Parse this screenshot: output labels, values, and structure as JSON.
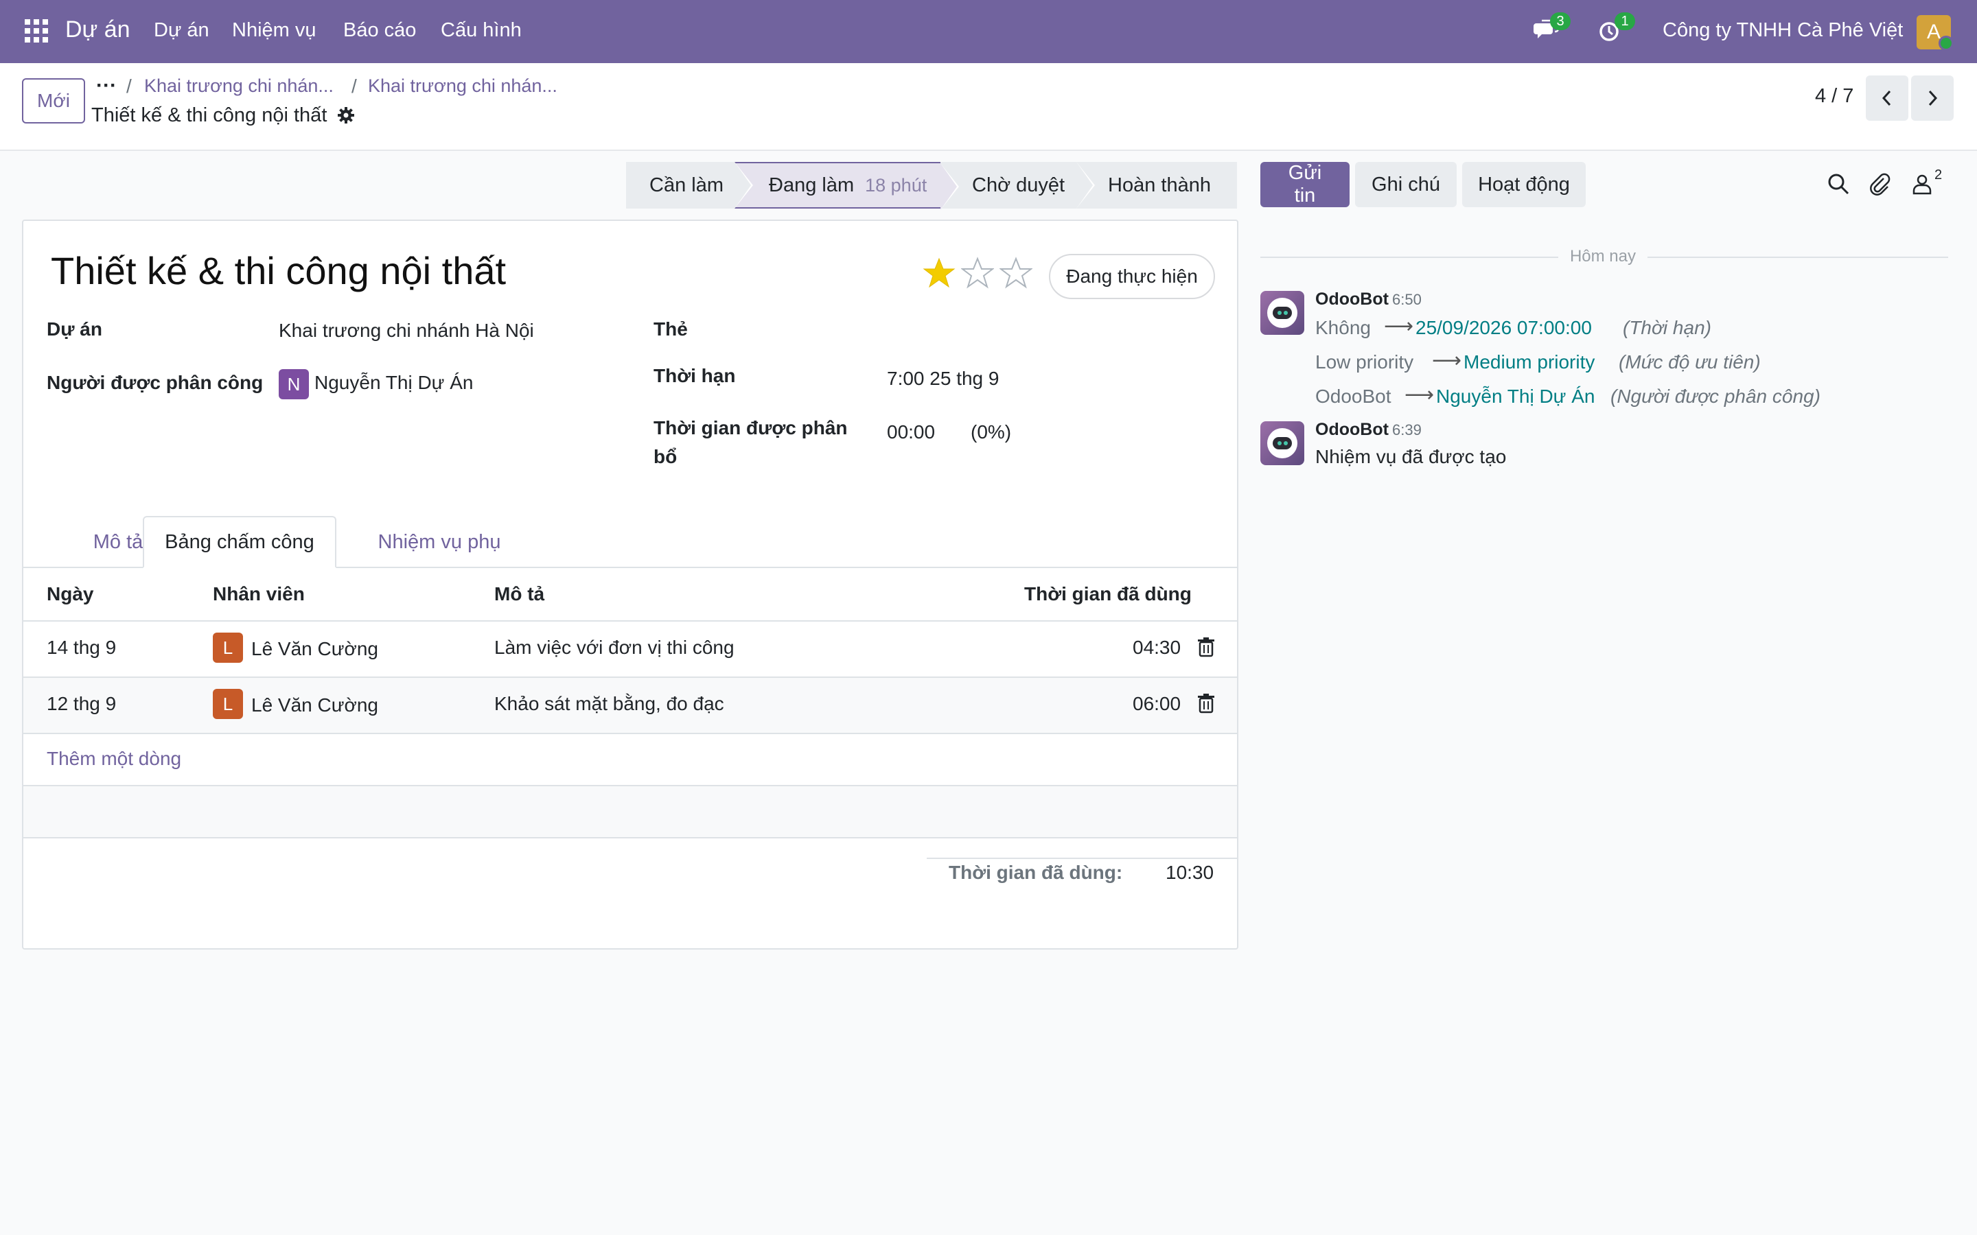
{
  "navbar": {
    "app_name": "Dự án",
    "menu": [
      "Dự án",
      "Nhiệm vụ",
      "Báo cáo",
      "Cấu hình"
    ],
    "messages_count": "3",
    "activities_count": "1",
    "company": "Công ty TNHH Cà Phê Việt",
    "user_initial": "A"
  },
  "control_panel": {
    "new_button": "Mới",
    "breadcrumbs": [
      "Khai trương chi nhán...",
      "Khai trương chi nhán..."
    ],
    "record_title": "Thiết kế & thi công nội thất",
    "pager": "4 / 7"
  },
  "statusbar": {
    "stages": [
      "Cần làm",
      "Đang làm",
      "Chờ duyệt",
      "Hoàn thành"
    ],
    "active_stage": "Đang làm",
    "active_duration": "18 phút"
  },
  "form": {
    "title": "Thiết kế & thi công nội thất",
    "priority_stars": 1,
    "priority_max": 3,
    "state_button": "Đang thực hiện",
    "fields": {
      "project_label": "Dự án",
      "project_value": "Khai trương chi nhánh Hà Nội",
      "assignee_label": "Người được phân công",
      "assignee_initial": "N",
      "assignee_value": "Nguyễn Thị Dự Án",
      "tags_label": "Thẻ",
      "deadline_label": "Thời hạn",
      "deadline_value": "7:00 25 thg 9",
      "allocated_label_1": "Thời gian được phân",
      "allocated_label_2": "bổ",
      "allocated_value": "00:00",
      "allocated_percent": "(0%)"
    },
    "tabs": [
      "Mô tả",
      "Bảng chấm công",
      "Nhiệm vụ phụ"
    ],
    "active_tab": "Bảng chấm công",
    "timesheet": {
      "headers": [
        "Ngày",
        "Nhân viên",
        "Mô tả",
        "Thời gian đã dùng"
      ],
      "rows": [
        {
          "date": "14 thg 9",
          "initial": "L",
          "employee": "Lê Văn Cường",
          "description": "Làm việc với đơn vị thi công",
          "duration": "04:30"
        },
        {
          "date": "12 thg 9",
          "initial": "L",
          "employee": "Lê Văn Cường",
          "description": "Khảo sát mặt bằng, đo đạc",
          "duration": "06:00"
        }
      ],
      "add_line": "Thêm một dòng",
      "total_label": "Thời gian đã dùng:",
      "total_value": "10:30"
    }
  },
  "chatter": {
    "send_message": "Gửi tin",
    "log_note": "Ghi chú",
    "activity": "Hoạt động",
    "followers_count": "2",
    "today": "Hôm nay",
    "messages": [
      {
        "author": "OdooBot",
        "time": "6:50",
        "tracking": [
          {
            "old": "Không",
            "new": "25/09/2026 07:00:00",
            "field": "(Thời hạn)"
          },
          {
            "old": "Low priority",
            "new": "Medium priority",
            "field": "(Mức độ ưu tiên)"
          },
          {
            "old": "OdooBot",
            "new": "Nguyễn Thị Dự Án",
            "field": "(Người được phân công)"
          }
        ]
      },
      {
        "author": "OdooBot",
        "time": "6:39",
        "body": "Nhiệm vụ đã được tạo"
      }
    ]
  },
  "colors": {
    "brand": "#71639e",
    "link_teal": "#017e84",
    "star": "#f3cc00",
    "avatar_orange": "#c75a28",
    "avatar_purple": "#7c4da1"
  }
}
